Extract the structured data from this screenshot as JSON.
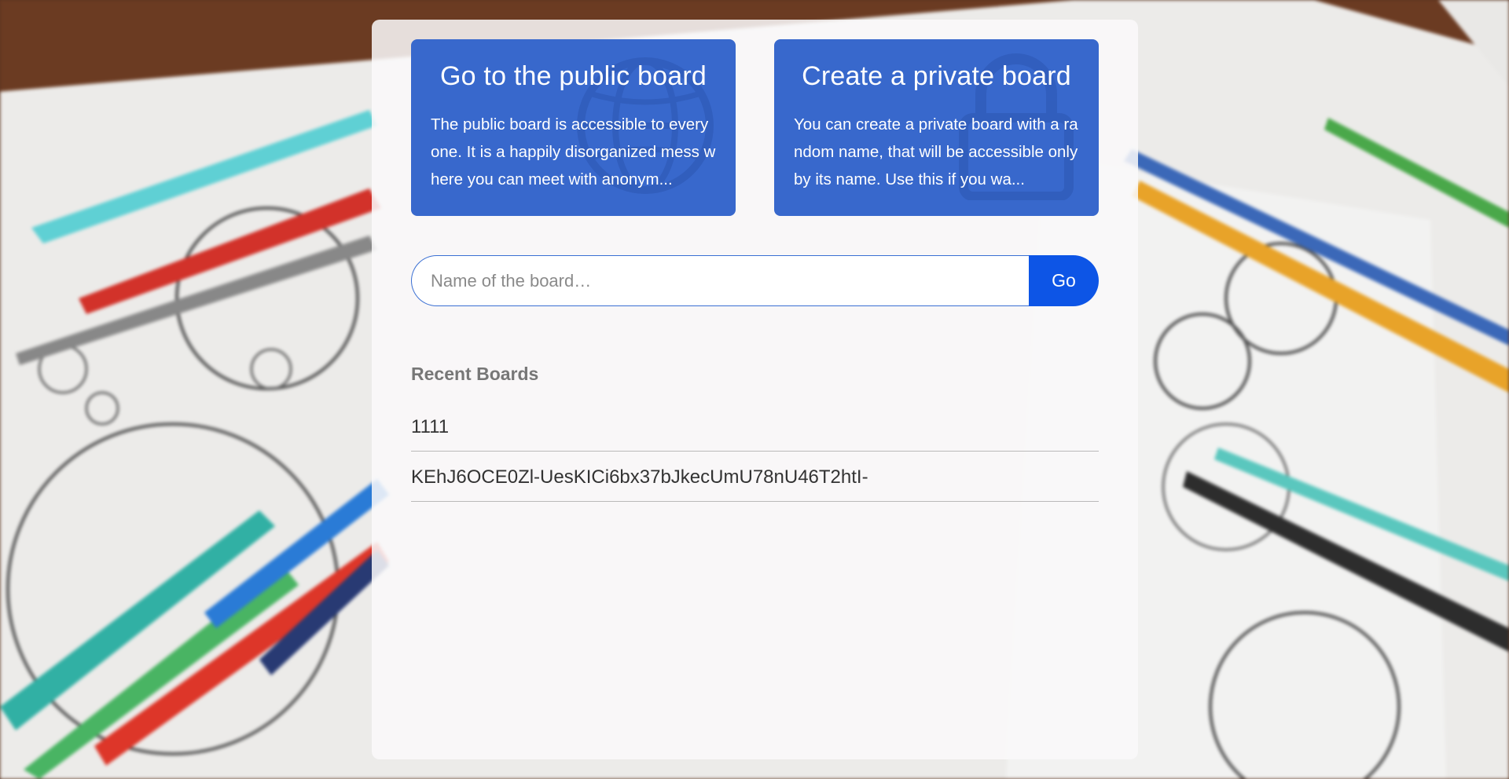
{
  "public_card": {
    "title": "Go to the public board",
    "description": "The public board is accessible to everyone. It is a happily disorganized mess where you can meet with anonym...",
    "icon": "globe-icon"
  },
  "private_card": {
    "title": "Create a private board",
    "description": "You can create a private board with a random name, that will be accessible only by its name. Use this if you wa...",
    "icon": "lock-icon"
  },
  "search": {
    "placeholder": "Name of the board…",
    "button_label": "Go"
  },
  "recent": {
    "title": "Recent Boards",
    "items": [
      "1111",
      "KEhJ6OCE0Zl-UesKICi6bx37bJkecUmU78nU46T2htI-"
    ]
  },
  "colors": {
    "card_bg": "#3868cc",
    "button_bg": "#0d55e6"
  }
}
